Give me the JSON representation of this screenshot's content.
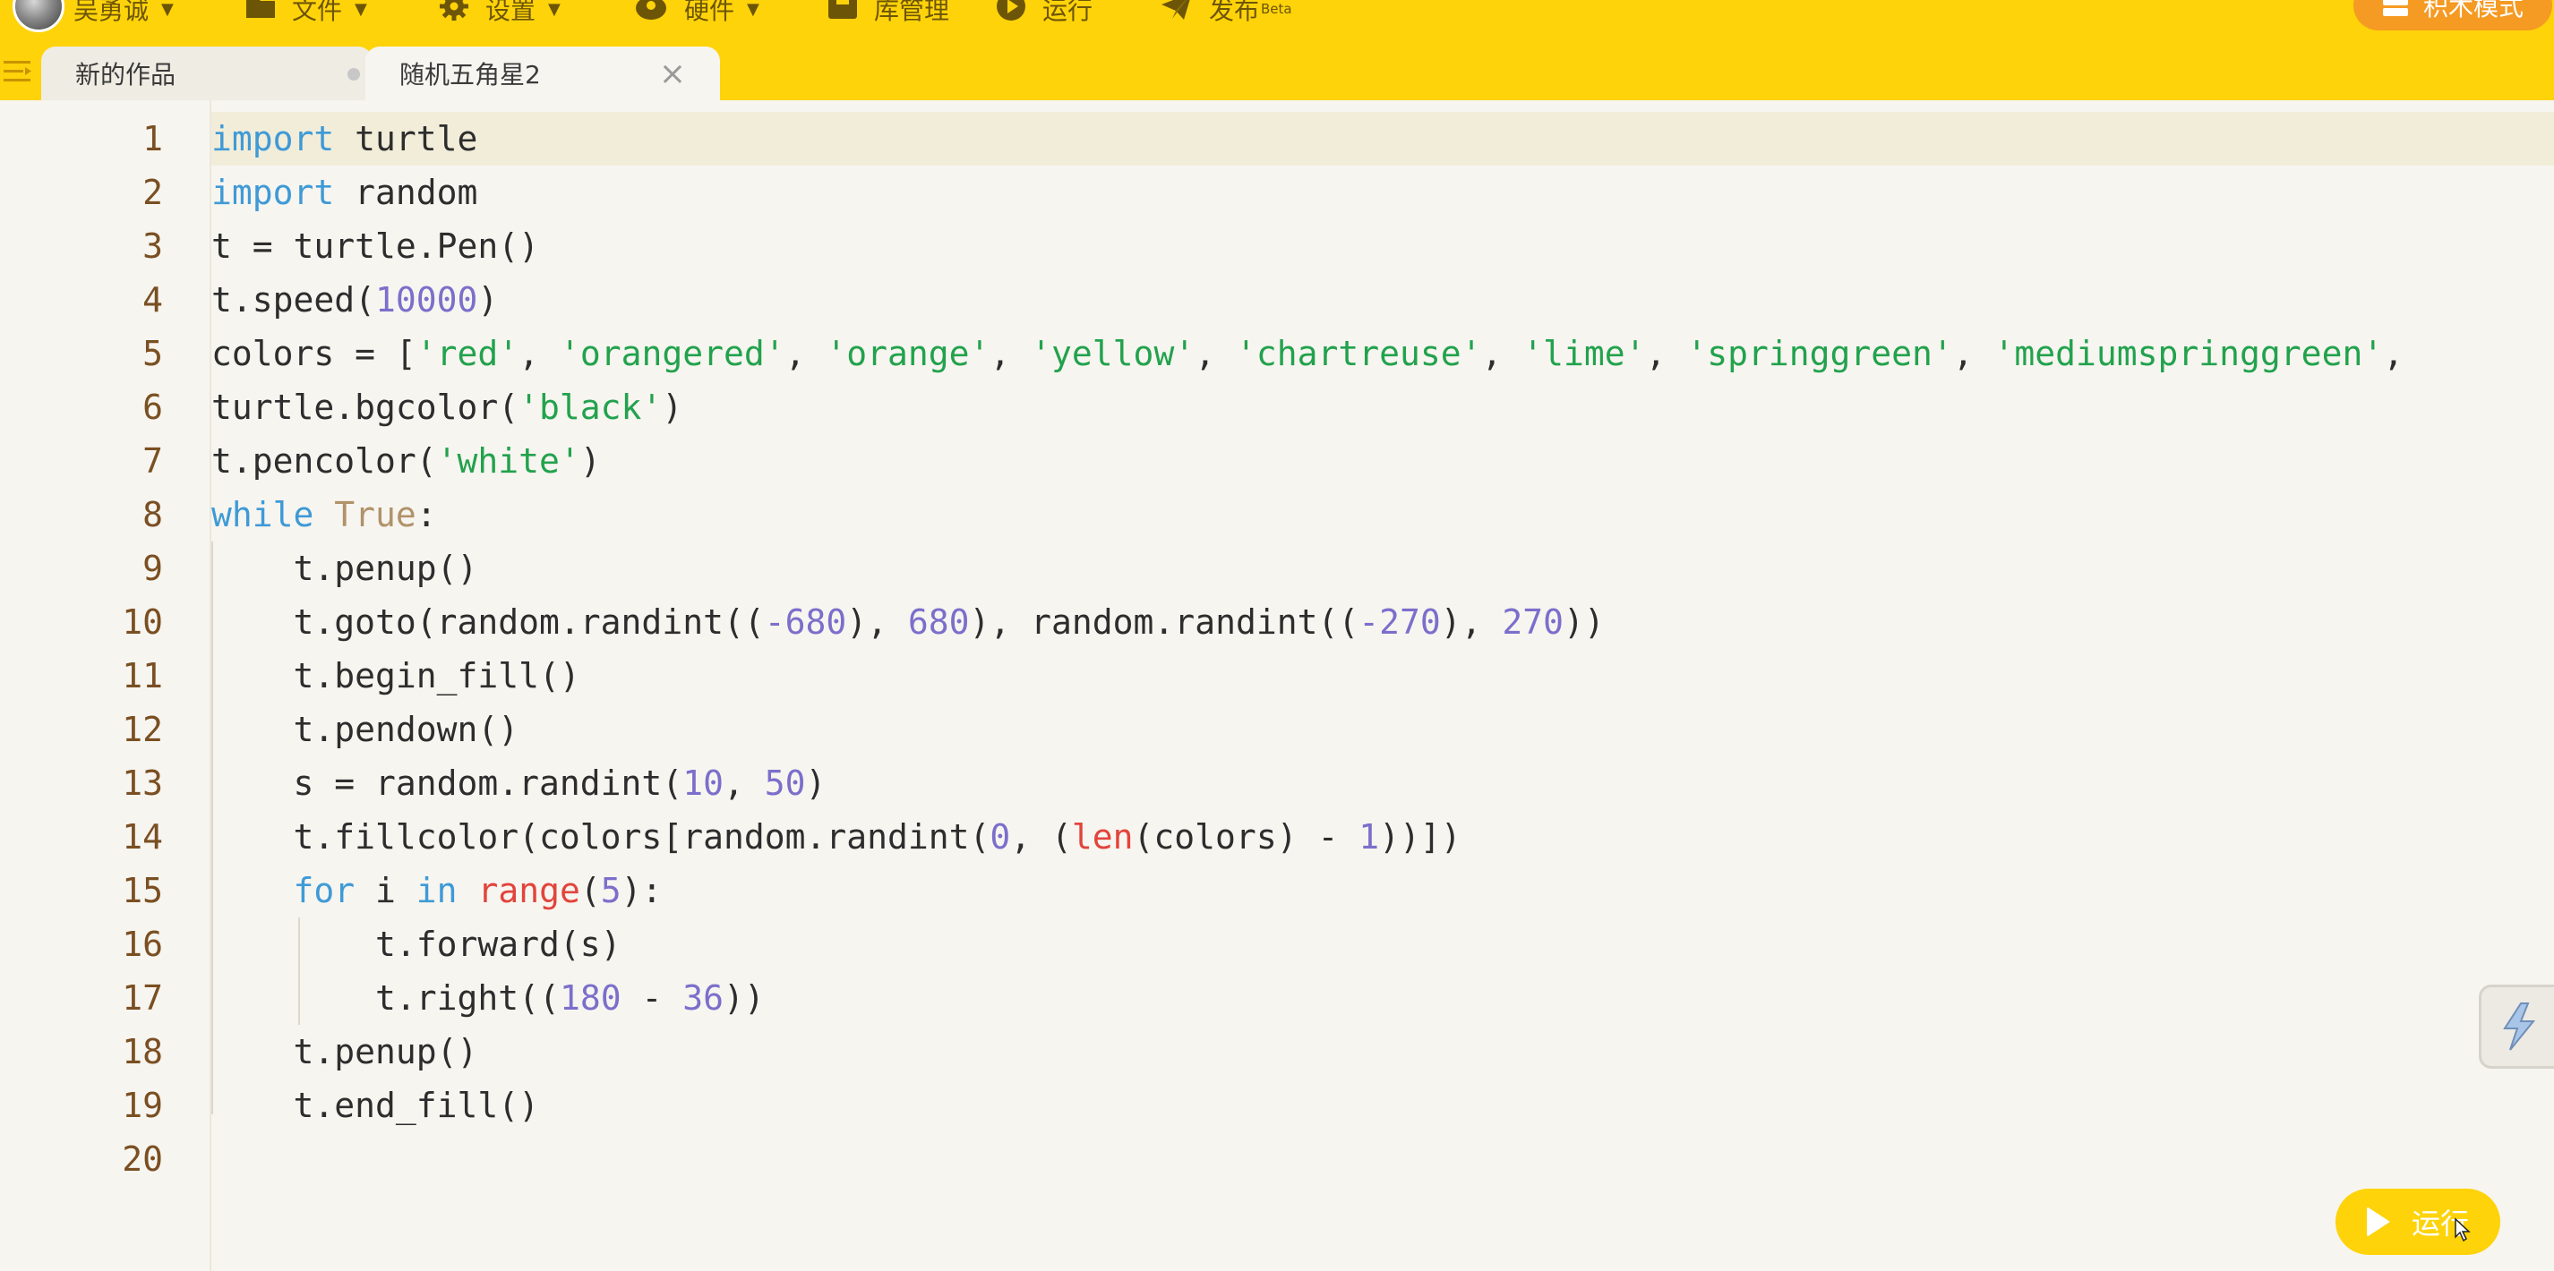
{
  "menubar": {
    "username": "吴勇诚",
    "items": [
      {
        "label": "文件",
        "icon": "folder-icon"
      },
      {
        "label": "设置",
        "icon": "gear-icon"
      },
      {
        "label": "硬件",
        "icon": "hardware-icon"
      },
      {
        "label": "库管理",
        "icon": "library-icon"
      },
      {
        "label": "运行",
        "icon": "play-icon"
      },
      {
        "label": "发布",
        "icon": "send-icon",
        "badge": "Beta"
      }
    ],
    "block_mode_label": "积木模式"
  },
  "tabs": [
    {
      "label": "新的作品",
      "active": false,
      "modified": true
    },
    {
      "label": "随机五角星2",
      "active": true
    }
  ],
  "editor": {
    "line_numbers": [
      "1",
      "2",
      "3",
      "4",
      "5",
      "6",
      "7",
      "8",
      "9",
      "10",
      "11",
      "12",
      "13",
      "14",
      "15",
      "16",
      "17",
      "18",
      "19",
      "20"
    ],
    "active_line": 1,
    "lines": [
      "import turtle",
      "import random",
      "t = turtle.Pen()",
      "t.speed(10000)",
      "colors = ['red', 'orangered', 'orange', 'yellow', 'chartreuse', 'lime', 'springgreen', 'mediumspringgreen',",
      "turtle.bgcolor('black')",
      "t.pencolor('white')",
      "while True:",
      "    t.penup()",
      "    t.goto(random.randint((-680), 680), random.randint((-270), 270))",
      "    t.begin_fill()",
      "    t.pendown()",
      "    s = random.randint(10, 50)",
      "    t.fillcolor(colors[random.randint(0, (len(colors) - 1))])",
      "    for i in range(5):",
      "        t.forward(s)",
      "        t.right((180 - 36))",
      "    t.penup()",
      "    t.end_fill()",
      ""
    ]
  },
  "run_button": {
    "label": "运行",
    "icon": "play-icon"
  },
  "colors": {
    "toolbar": "#fed309",
    "keyword": "#3f9ad6",
    "string": "#22a24d",
    "number": "#7b6fcb",
    "builtin": "#e2443b",
    "line_number": "#7a4f22",
    "block_mode": "#f59a23"
  }
}
